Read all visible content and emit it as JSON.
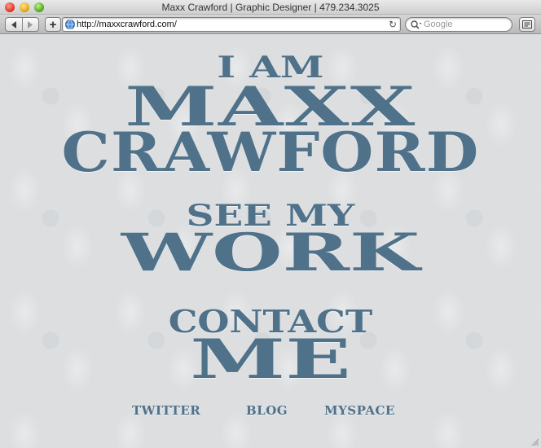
{
  "window": {
    "title": "Maxx Crawford | Graphic Designer | 479.234.3025"
  },
  "toolbar": {
    "url": "http://maxxcrawford.com/",
    "search_placeholder": "Google",
    "add_label": "+"
  },
  "hero": {
    "line1": "I AM",
    "line2": "MAXX",
    "line3": "CRAWFORD"
  },
  "work": {
    "line1": "SEE MY",
    "line2": "WORK"
  },
  "contact": {
    "line1": "CONTACT",
    "line2": "ME"
  },
  "links": [
    {
      "label": "TWITTER"
    },
    {
      "label": "BLOG"
    },
    {
      "label": "MYSPACE"
    }
  ],
  "colors": {
    "accent": "#4f7189",
    "background": "#dcdee0"
  },
  "icons": {
    "back": "back-arrow-icon",
    "forward": "forward-arrow-icon",
    "site": "globe-icon",
    "reload": "reload-icon",
    "search": "search-icon",
    "bookmarks": "bookmarks-icon"
  }
}
